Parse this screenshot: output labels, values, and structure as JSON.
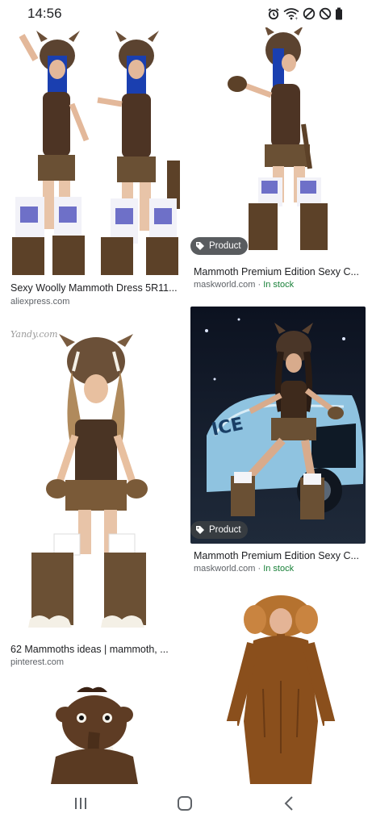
{
  "status_bar": {
    "time": "14:56",
    "icons": [
      "alarm-icon",
      "wifi-icon",
      "dnd-icon",
      "blocked-icon",
      "battery-icon"
    ]
  },
  "results": [
    {
      "title": "Sexy Woolly Mammoth Dress 5R11...",
      "source": "aliexpress.com",
      "stock": "",
      "badge": ""
    },
    {
      "title": "Mammoth Premium Edition Sexy C...",
      "source": "maskworld.com",
      "stock": "In stock",
      "badge": "Product"
    },
    {
      "title": "62 Mammoths ideas | mammoth, ...",
      "source": "pinterest.com",
      "stock": "",
      "badge": "",
      "watermark": "Yandy.com"
    },
    {
      "title": "Mammoth Premium Edition Sexy C...",
      "source": "maskworld.com",
      "stock": "In stock",
      "badge": "Product"
    },
    {
      "title": "",
      "source": "",
      "stock": "",
      "badge": ""
    },
    {
      "title": "",
      "source": "",
      "stock": "",
      "badge": ""
    }
  ],
  "separator": " · ",
  "nav_bar": {
    "buttons": [
      "recent-apps-icon",
      "home-icon",
      "back-icon"
    ]
  },
  "colors": {
    "in_stock": "#188038",
    "badge_bg": "#3c4043",
    "source_text": "#5f6368"
  }
}
